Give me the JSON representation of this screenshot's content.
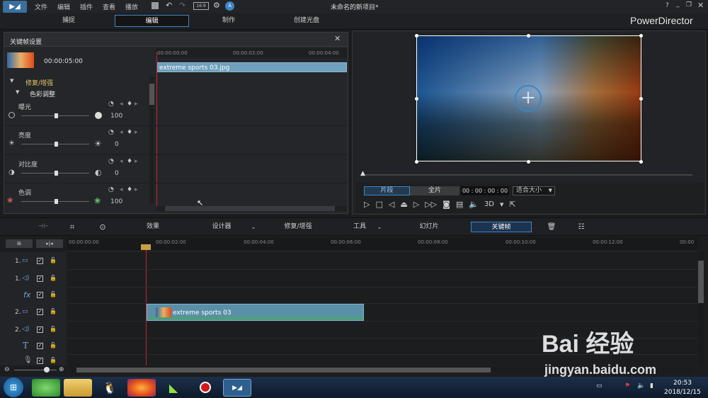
{
  "menu": {
    "items": [
      "文件",
      "编辑",
      "插件",
      "查看",
      "播放"
    ],
    "title": "未命名的新项目*",
    "win_help": "?"
  },
  "modes": {
    "capture": "捕捉",
    "edit": "编辑",
    "produce": "制作",
    "disc": "创建光盘",
    "brand": "PowerDirector"
  },
  "kf": {
    "title": "关键帧设置",
    "duration": "00:00:05:00",
    "ruler": [
      "00:00:00:00",
      "00:00:02:00",
      "00:00:04:00"
    ],
    "clip_name": "extreme sports 03.jpg",
    "section": "修复/增强",
    "subsection": "色彩调整",
    "params": [
      {
        "label": "曝光",
        "value": "100"
      },
      {
        "label": "亮度",
        "value": "0"
      },
      {
        "label": "对比度",
        "value": "0"
      },
      {
        "label": "色调",
        "value": "100"
      }
    ]
  },
  "preview": {
    "clip_tab": "片段",
    "full_tab": "全片",
    "timecode": "00 : 00 : 00 : 00",
    "fit": "适合大小",
    "mode3d": "3D"
  },
  "toolbar": {
    "effects": "效果",
    "designer": "设计器",
    "fix": "修复/增强",
    "tools": "工具",
    "slideshow": "幻灯片",
    "keyframe": "关键帧"
  },
  "timeline": {
    "ruler": [
      "00:00:00:00",
      "00:00:02:00",
      "00:00:04:00",
      "00:00:06:00",
      "00:00:08:00",
      "00:00:10:00",
      "00:00:12:00",
      "00:00"
    ],
    "tracks": [
      "1.",
      "1.",
      "",
      "2.",
      "2.",
      "",
      ""
    ],
    "clip_name": "extreme sports 03"
  },
  "taskbar": {
    "time": "20:53",
    "date": "2018/12/15"
  },
  "watermark": {
    "brand": "Bai  经验",
    "url": "jingyan.baidu.com"
  },
  "colors": {
    "accent": "#3b86c6",
    "clip": "#5a8fa8",
    "playhead": "#c0282d"
  }
}
